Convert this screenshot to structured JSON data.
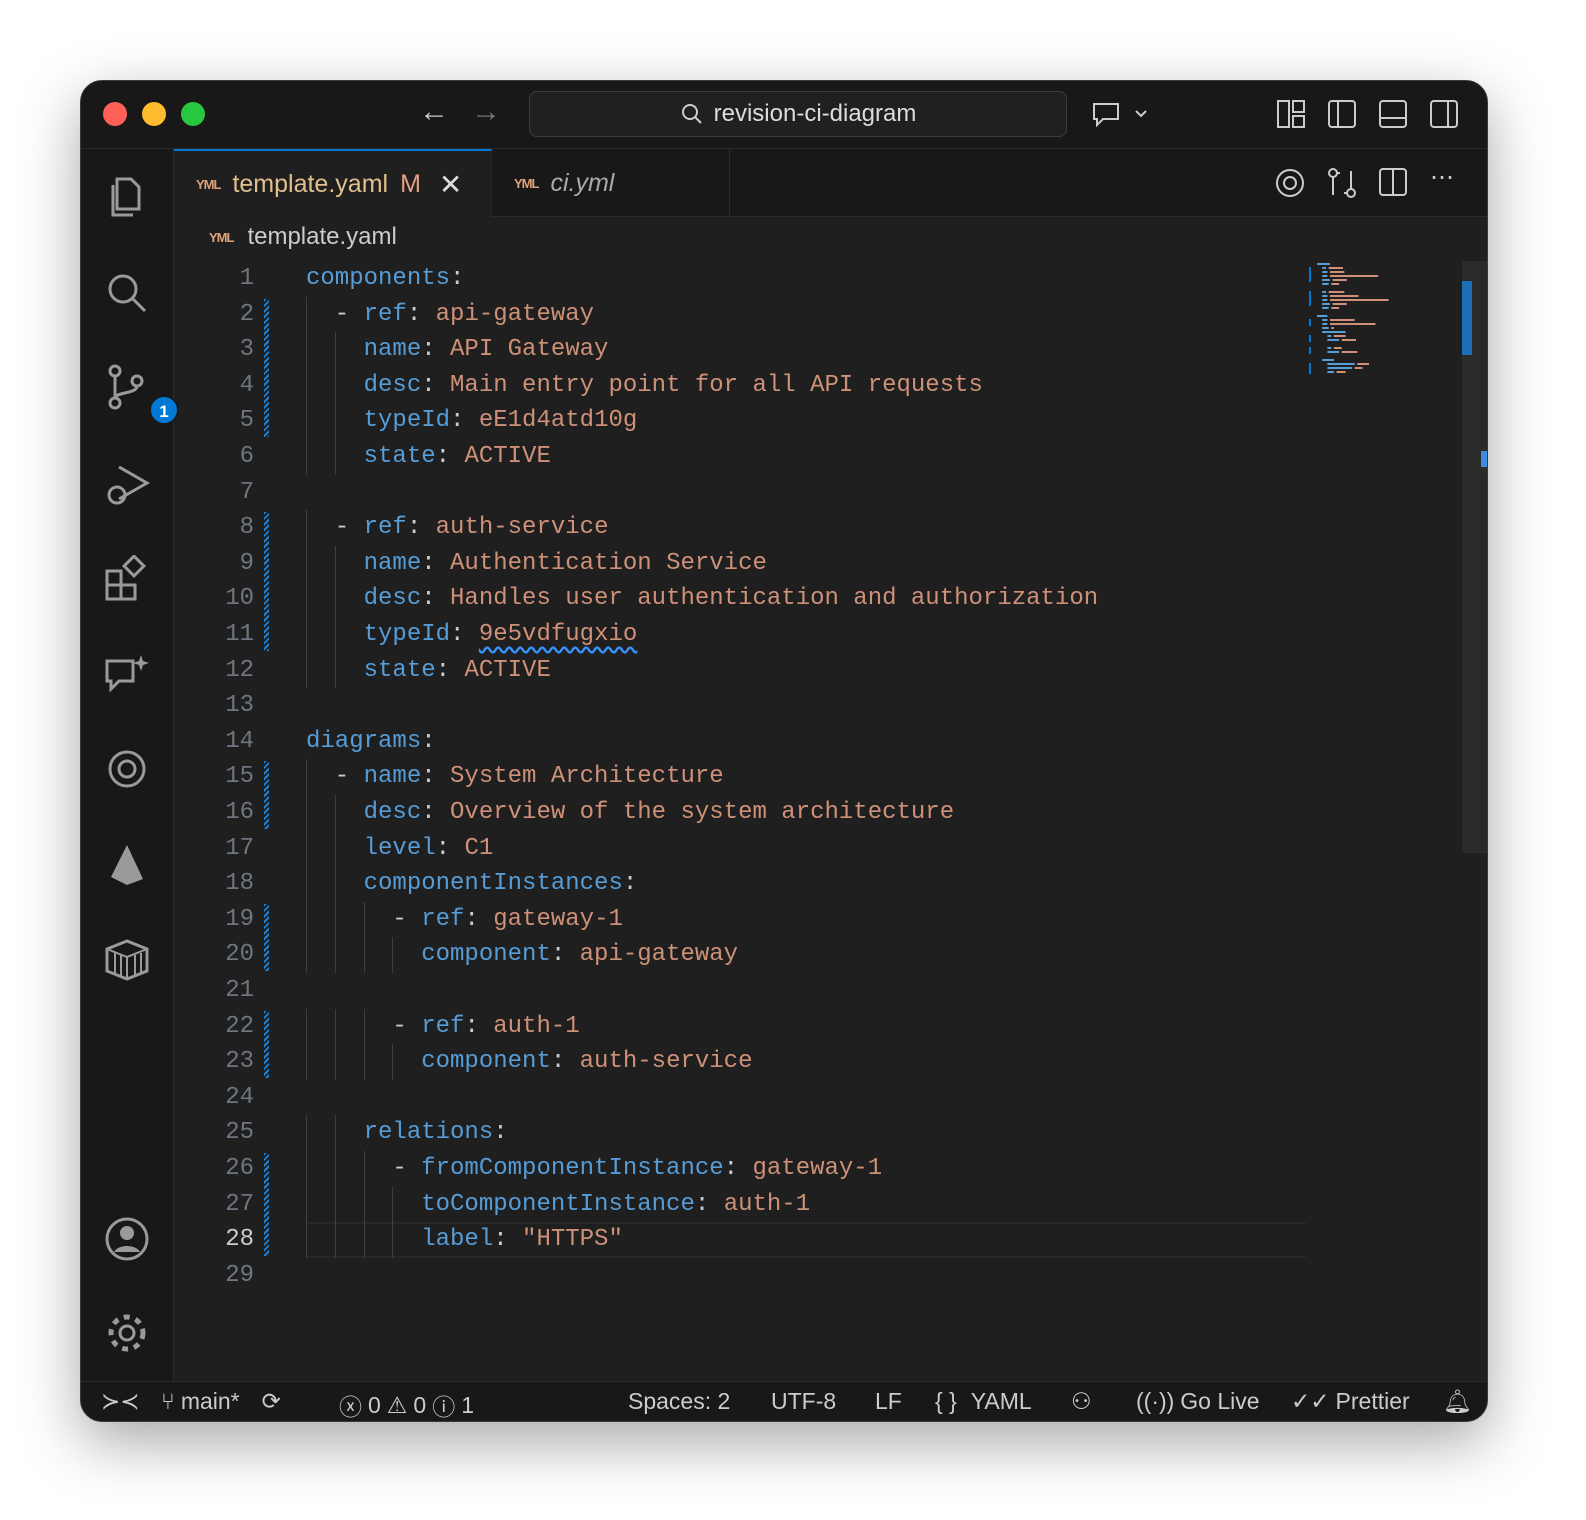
{
  "titlebar": {
    "search": "revision-ci-diagram"
  },
  "activity": {
    "scm_badge": "1"
  },
  "tabs": [
    {
      "label": "template.yaml",
      "status": "M",
      "active": true
    },
    {
      "label": "ci.yml",
      "active": false
    }
  ],
  "tab_icon": "YML",
  "breadcrumb": {
    "file": "template.yaml"
  },
  "colors": {
    "key": "#569cd6",
    "value": "#ce9178",
    "accent": "#0078d4"
  },
  "code": {
    "current_line": 28,
    "lines": [
      {
        "n": "1",
        "indent": "",
        "key": "components",
        "value": ""
      },
      {
        "n": "2",
        "indent": "  - ",
        "key": "ref",
        "value": "api-gateway"
      },
      {
        "n": "3",
        "indent": "    ",
        "key": "name",
        "value": "API Gateway"
      },
      {
        "n": "4",
        "indent": "    ",
        "key": "desc",
        "value": "Main entry point for all API requests"
      },
      {
        "n": "5",
        "indent": "    ",
        "key": "typeId",
        "value": "eE1d4atd10g"
      },
      {
        "n": "6",
        "indent": "    ",
        "key": "state",
        "value": "ACTIVE"
      },
      {
        "n": "7",
        "indent": "",
        "key": "",
        "value": ""
      },
      {
        "n": "8",
        "indent": "  - ",
        "key": "ref",
        "value": "auth-service"
      },
      {
        "n": "9",
        "indent": "    ",
        "key": "name",
        "value": "Authentication Service"
      },
      {
        "n": "10",
        "indent": "    ",
        "key": "desc",
        "value": "Handles user authentication and authorization"
      },
      {
        "n": "11",
        "indent": "    ",
        "key": "typeId",
        "value": "9e5vdfugxio",
        "squiggle": true
      },
      {
        "n": "12",
        "indent": "    ",
        "key": "state",
        "value": "ACTIVE"
      },
      {
        "n": "13",
        "indent": "",
        "key": "",
        "value": ""
      },
      {
        "n": "14",
        "indent": "",
        "key": "diagrams",
        "value": ""
      },
      {
        "n": "15",
        "indent": "  - ",
        "key": "name",
        "value": "System Architecture"
      },
      {
        "n": "16",
        "indent": "    ",
        "key": "desc",
        "value": "Overview of the system architecture"
      },
      {
        "n": "17",
        "indent": "    ",
        "key": "level",
        "value": "C1"
      },
      {
        "n": "18",
        "indent": "    ",
        "key": "componentInstances",
        "value": ""
      },
      {
        "n": "19",
        "indent": "      - ",
        "key": "ref",
        "value": "gateway-1"
      },
      {
        "n": "20",
        "indent": "        ",
        "key": "component",
        "value": "api-gateway"
      },
      {
        "n": "21",
        "indent": "",
        "key": "",
        "value": ""
      },
      {
        "n": "22",
        "indent": "      - ",
        "key": "ref",
        "value": "auth-1"
      },
      {
        "n": "23",
        "indent": "        ",
        "key": "component",
        "value": "auth-service"
      },
      {
        "n": "24",
        "indent": "",
        "key": "",
        "value": ""
      },
      {
        "n": "25",
        "indent": "    ",
        "key": "relations",
        "value": ""
      },
      {
        "n": "26",
        "indent": "      - ",
        "key": "fromComponentInstance",
        "value": "gateway-1"
      },
      {
        "n": "27",
        "indent": "        ",
        "key": "toComponentInstance",
        "value": "auth-1"
      },
      {
        "n": "28",
        "indent": "        ",
        "key": "label",
        "value": "\"HTTPS\""
      },
      {
        "n": "29",
        "indent": "",
        "key": "",
        "value": ""
      }
    ],
    "changed_ranges": [
      [
        2,
        5
      ],
      [
        8,
        11
      ],
      [
        15,
        16
      ],
      [
        19,
        20
      ],
      [
        22,
        23
      ],
      [
        26,
        28
      ]
    ]
  },
  "status": {
    "branch": "main*",
    "errors": "0",
    "warnings": "0",
    "info": "1",
    "spaces": "Spaces: 2",
    "encoding": "UTF-8",
    "eol": "LF",
    "language": "YAML",
    "language_icon": "{ }",
    "golive": "Go Live",
    "prettier": "Prettier"
  }
}
